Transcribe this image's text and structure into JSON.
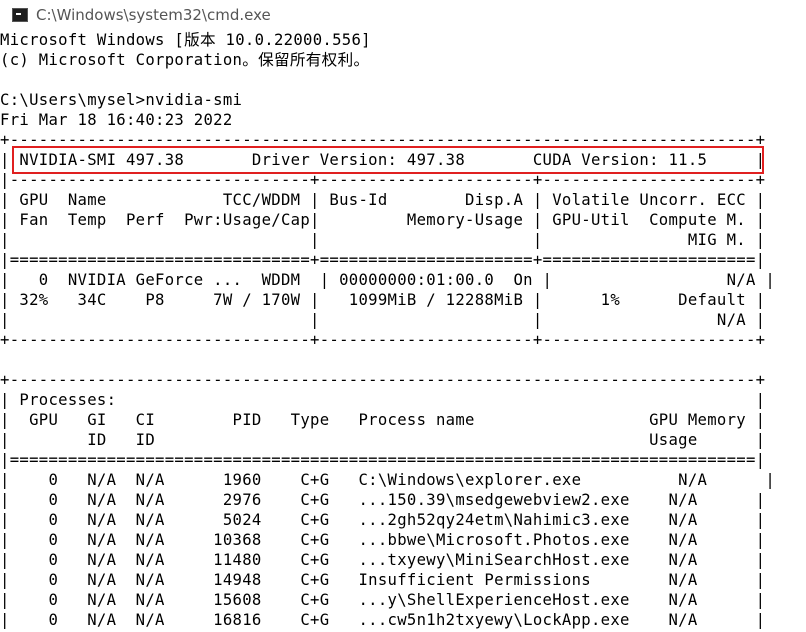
{
  "window": {
    "title": "C:\\Windows\\system32\\cmd.exe",
    "icon": "cmd-icon"
  },
  "console": {
    "lines": [
      "Microsoft Windows [版本 10.0.22000.556]",
      "(c) Microsoft Corporation。保留所有权利。",
      "",
      "C:\\Users\\mysel>nvidia-smi",
      "Fri Mar 18 16:40:23 2022",
      "+-----------------------------------------------------------------------------+",
      "| NVIDIA-SMI 497.38       Driver Version: 497.38       CUDA Version: 11.5     |",
      "|-------------------------------+----------------------+----------------------+",
      "| GPU  Name            TCC/WDDM | Bus-Id        Disp.A | Volatile Uncorr. ECC |",
      "| Fan  Temp  Perf  Pwr:Usage/Cap|         Memory-Usage | GPU-Util  Compute M. |",
      "|                               |                      |               MIG M. |",
      "|===============================+======================+======================|",
      "|   0  NVIDIA GeForce ...  WDDM  | 00000000:01:00.0  On |                  N/A |",
      "| 32%   34C    P8     7W / 170W |   1099MiB / 12288MiB |      1%      Default |",
      "|                               |                      |                  N/A |",
      "+-------------------------------+----------------------+----------------------+",
      "",
      "+-----------------------------------------------------------------------------+",
      "| Processes:                                                                  |",
      "|  GPU   GI   CI        PID   Type   Process name                  GPU Memory |",
      "|        ID   ID                                                   Usage      |",
      "|=============================================================================|",
      "|    0   N/A  N/A      1960    C+G   C:\\Windows\\explorer.exe          N/A      |",
      "|    0   N/A  N/A      2976    C+G   ...150.39\\msedgewebview2.exe    N/A      |",
      "|    0   N/A  N/A      5024    C+G   ...2gh52qy24etm\\Nahimic3.exe    N/A      |",
      "|    0   N/A  N/A     10368    C+G   ...bbwe\\Microsoft.Photos.exe    N/A      |",
      "|    0   N/A  N/A     11480    C+G   ...txyewy\\MiniSearchHost.exe    N/A      |",
      "|    0   N/A  N/A     14948    C+G   Insufficient Permissions        N/A      |",
      "|    0   N/A  N/A     15608    C+G   ...y\\ShellExperienceHost.exe    N/A      |",
      "|    0   N/A  N/A     16816    C+G   ...cw5n1h2txyewy\\LockApp.exe    N/A      |"
    ]
  }
}
